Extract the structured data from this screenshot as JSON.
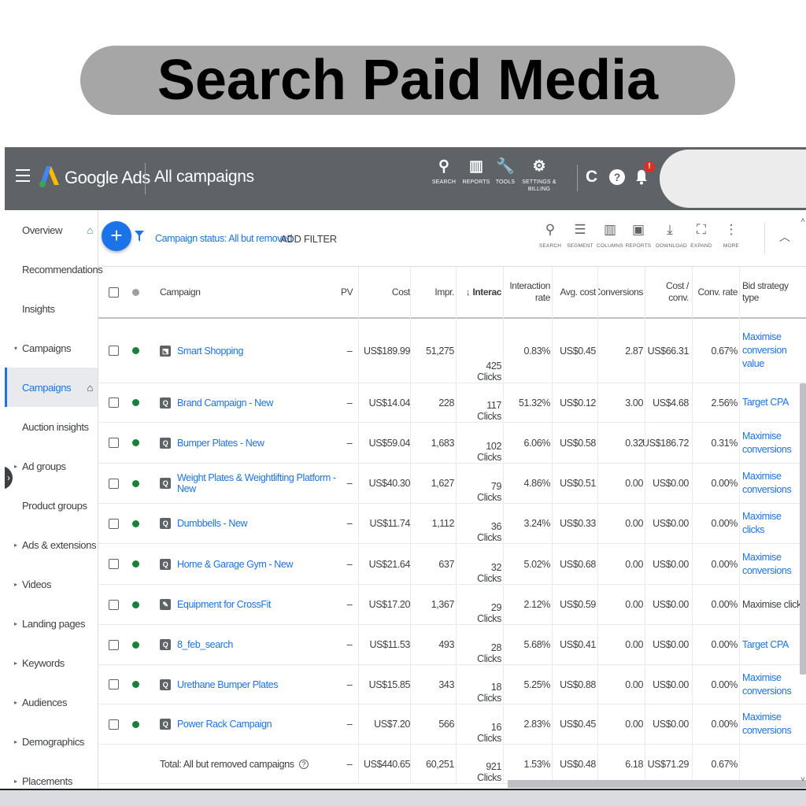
{
  "banner": {
    "title": "Search Paid Media"
  },
  "topbar": {
    "brand": "Google Ads",
    "page_title": "All campaigns",
    "tools": [
      {
        "icon": "search-icon",
        "glyph": "⚲",
        "label": "SEARCH"
      },
      {
        "icon": "reports-icon",
        "glyph": "▥",
        "label": "REPORTS"
      },
      {
        "icon": "wrench-icon",
        "glyph": "🔧",
        "label": "TOOLS"
      },
      {
        "icon": "gear-icon",
        "glyph": "⚙",
        "label": "SETTINGS &\nBILLING"
      }
    ],
    "refresh_glyph": "C",
    "help_glyph": "?",
    "notification_count": "!"
  },
  "sidebar": {
    "items": [
      {
        "label": "Overview",
        "home": true
      },
      {
        "label": "Recommendations"
      },
      {
        "label": "Insights"
      },
      {
        "label": "Campaigns",
        "arrow": "▾"
      },
      {
        "label": "Campaigns",
        "active": true,
        "home": true
      },
      {
        "label": "Auction insights"
      },
      {
        "label": "Ad groups",
        "arrow": "▸"
      },
      {
        "label": "Product groups"
      },
      {
        "label": "Ads & extensions",
        "arrow": "▸"
      },
      {
        "label": "Videos",
        "arrow": "▸"
      },
      {
        "label": "Landing pages",
        "arrow": "▸"
      },
      {
        "label": "Keywords",
        "arrow": "▸"
      },
      {
        "label": "Audiences",
        "arrow": "▸"
      },
      {
        "label": "Demographics",
        "arrow": "▸"
      },
      {
        "label": "Placements",
        "arrow": "▸"
      }
    ]
  },
  "filterbar": {
    "status_prefix": "Campaign status: ",
    "status_value": "All but removed",
    "add_filter": "ADD FILTER",
    "actions": [
      {
        "icon": "search-icon",
        "glyph": "⚲",
        "label": "SEARCH"
      },
      {
        "icon": "segment-icon",
        "glyph": "☰",
        "label": "SEGMENT"
      },
      {
        "icon": "columns-icon",
        "glyph": "▥",
        "label": "COLUMNS"
      },
      {
        "icon": "reports-icon",
        "glyph": "▣",
        "label": "REPORTS"
      },
      {
        "icon": "download-icon",
        "glyph": "⤓",
        "label": "DOWNLOAD"
      },
      {
        "icon": "expand-icon",
        "glyph": "⛶",
        "label": "EXPAND"
      },
      {
        "icon": "more-icon",
        "glyph": "⋮",
        "label": "MORE"
      }
    ]
  },
  "table": {
    "headers": {
      "campaign": "Campaign",
      "cpv": "PV",
      "cost": "Cost",
      "impr": "Impr.",
      "interactions": "↓ Interac",
      "interaction_rate": "Interaction rate",
      "avg_cost": "Avg. cost",
      "conversions": "Conversions",
      "cost_conv": "Cost / conv.",
      "conv_rate": "Conv. rate",
      "bid_strategy": "Bid strategy type"
    },
    "rows": [
      {
        "name": "Smart Shopping",
        "type": "shopping",
        "cpv": "–",
        "cost": "US$189.99",
        "impr": "51,275",
        "interactions": "425",
        "unit": "Clicks",
        "rate": "0.83%",
        "avg": "US$0.45",
        "conv": "2.87",
        "cpc": "US$66.31",
        "convrate": "0.67%",
        "bid": "Maximise conversion value",
        "bid_link": true
      },
      {
        "name": "Brand Campaign - New",
        "type": "search",
        "cpv": "–",
        "cost": "US$14.04",
        "impr": "228",
        "interactions": "117",
        "unit": "Clicks",
        "rate": "51.32%",
        "avg": "US$0.12",
        "conv": "3.00",
        "cpc": "US$4.68",
        "convrate": "2.56%",
        "bid": "Target CPA",
        "bid_link": true
      },
      {
        "name": "Bumper Plates - New",
        "type": "search",
        "cpv": "–",
        "cost": "US$59.04",
        "impr": "1,683",
        "interactions": "102",
        "unit": "Clicks",
        "rate": "6.06%",
        "avg": "US$0.58",
        "conv": "0.32",
        "cpc": "US$186.72",
        "convrate": "0.31%",
        "bid": "Maximise conversions",
        "bid_link": true
      },
      {
        "name": "Weight Plates & Weightlifting Platform - New",
        "type": "search",
        "cpv": "–",
        "cost": "US$40.30",
        "impr": "1,627",
        "interactions": "79",
        "unit": "Clicks",
        "rate": "4.86%",
        "avg": "US$0.51",
        "conv": "0.00",
        "cpc": "US$0.00",
        "convrate": "0.00%",
        "bid": "Maximise conversions",
        "bid_link": true
      },
      {
        "name": "Dumbbells - New",
        "type": "search",
        "cpv": "–",
        "cost": "US$11.74",
        "impr": "1,112",
        "interactions": "36",
        "unit": "Clicks",
        "rate": "3.24%",
        "avg": "US$0.33",
        "conv": "0.00",
        "cpc": "US$0.00",
        "convrate": "0.00%",
        "bid": "Maximise clicks",
        "bid_link": true
      },
      {
        "name": "Home & Garage Gym - New",
        "type": "search",
        "cpv": "–",
        "cost": "US$21.64",
        "impr": "637",
        "interactions": "32",
        "unit": "Clicks",
        "rate": "5.02%",
        "avg": "US$0.68",
        "conv": "0.00",
        "cpc": "US$0.00",
        "convrate": "0.00%",
        "bid": "Maximise conversions",
        "bid_link": true
      },
      {
        "name": "Equipment for CrossFit",
        "type": "smart",
        "cpv": "–",
        "cost": "US$17.20",
        "impr": "1,367",
        "interactions": "29",
        "unit": "Clicks",
        "rate": "2.12%",
        "avg": "US$0.59",
        "conv": "0.00",
        "cpc": "US$0.00",
        "convrate": "0.00%",
        "bid": "Maximise clicks",
        "bid_link": false
      },
      {
        "name": "8_feb_search",
        "type": "search",
        "cpv": "–",
        "cost": "US$11.53",
        "impr": "493",
        "interactions": "28",
        "unit": "Clicks",
        "rate": "5.68%",
        "avg": "US$0.41",
        "conv": "0.00",
        "cpc": "US$0.00",
        "convrate": "0.00%",
        "bid": "Target CPA",
        "bid_link": true
      },
      {
        "name": "Urethane Bumper Plates",
        "type": "search",
        "cpv": "–",
        "cost": "US$15.85",
        "impr": "343",
        "interactions": "18",
        "unit": "Clicks",
        "rate": "5.25%",
        "avg": "US$0.88",
        "conv": "0.00",
        "cpc": "US$0.00",
        "convrate": "0.00%",
        "bid": "Maximise conversions",
        "bid_link": true
      },
      {
        "name": "Power Rack Campaign",
        "type": "search",
        "cpv": "–",
        "cost": "US$7.20",
        "impr": "566",
        "interactions": "16",
        "unit": "Clicks",
        "rate": "2.83%",
        "avg": "US$0.45",
        "conv": "0.00",
        "cpc": "US$0.00",
        "convrate": "0.00%",
        "bid": "Maximise conversions",
        "bid_link": true
      }
    ],
    "total": {
      "label": "Total: All but removed campaigns",
      "cpv": "–",
      "cost": "US$440.65",
      "impr": "60,251",
      "interactions": "921",
      "unit": "Clicks",
      "rate": "1.53%",
      "avg": "US$0.48",
      "conv": "6.18",
      "cpc": "US$71.29",
      "convrate": "0.67%"
    }
  },
  "colors": {
    "topbar": "#5f6368",
    "accent": "#1a73e8",
    "enabled": "#188038",
    "banner": "#a6a6a6"
  }
}
